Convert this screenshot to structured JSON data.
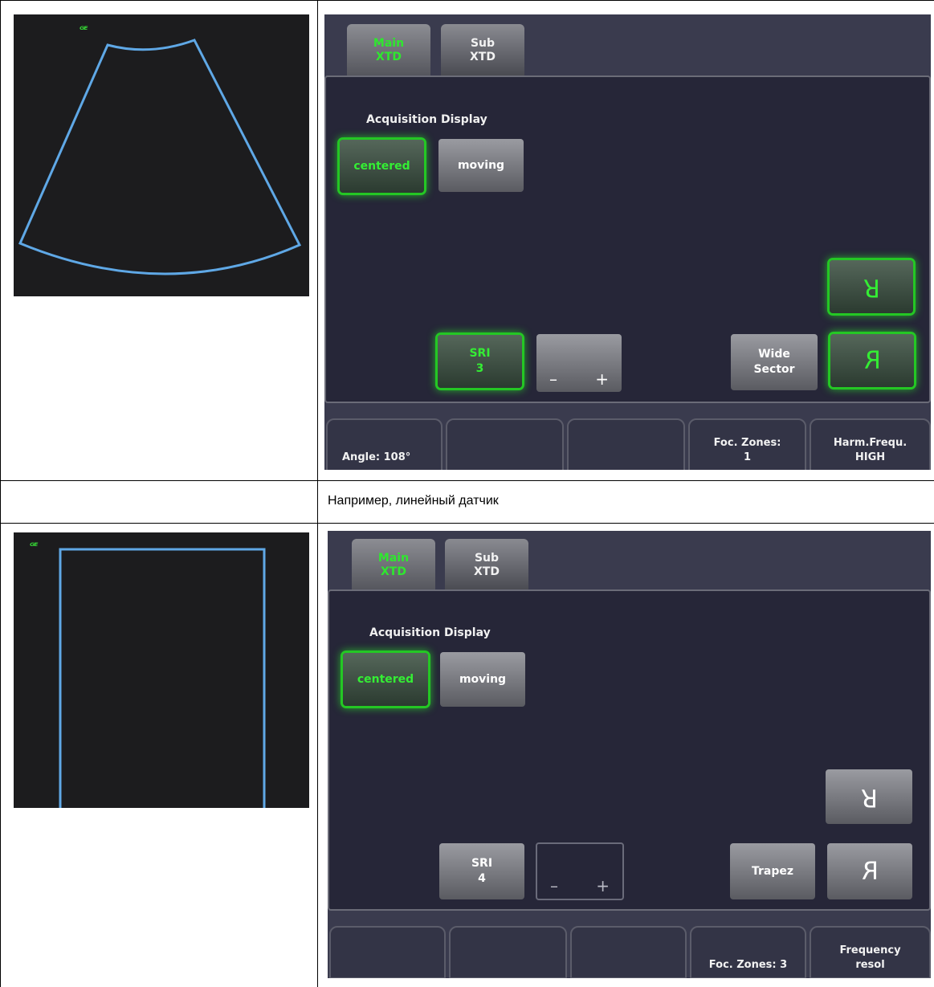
{
  "caption": "Например, линейный датчик",
  "colors": {
    "outline": "#5fa8e6",
    "active_green": "#2ee82e",
    "logo_green": "#35d435"
  },
  "block1": {
    "logo": "ᴳᴱ",
    "tabs": [
      {
        "line1": "Main",
        "line2": "XTD",
        "active": true
      },
      {
        "line1": "Sub",
        "line2": "XTD",
        "active": false
      }
    ],
    "section_label": "Acquisition Display",
    "centered_label": "centered",
    "moving_label": "moving",
    "sri_label": "SRI",
    "sri_value": "3",
    "minus": "–",
    "plus": "+",
    "wide_line1": "Wide",
    "wide_line2": "Sector",
    "flip_lr_glyph": "R",
    "flip_ud_glyph": "R",
    "status": [
      {
        "line1": "Angle:   108°",
        "line2": ""
      },
      {
        "line1": "",
        "line2": ""
      },
      {
        "line1": "",
        "line2": ""
      },
      {
        "line1": "Foc. Zones:",
        "line2": "1"
      },
      {
        "line1": "Harm.Frequ.",
        "line2": "HIGH"
      }
    ]
  },
  "block2": {
    "logo": "ᴳᴱ",
    "tabs": [
      {
        "line1": "Main",
        "line2": "XTD",
        "active": true
      },
      {
        "line1": "Sub",
        "line2": "XTD",
        "active": false
      }
    ],
    "section_label": "Acquisition Display",
    "centered_label": "centered",
    "moving_label": "moving",
    "sri_label": "SRI",
    "sri_value": "4",
    "minus": "–",
    "plus": "+",
    "trapez_label": "Trapez",
    "flip_lr_glyph": "R",
    "flip_ud_glyph": "R",
    "status": [
      {
        "line1": "",
        "line2": ""
      },
      {
        "line1": "",
        "line2": ""
      },
      {
        "line1": "",
        "line2": ""
      },
      {
        "line1": "Foc. Zones: 3",
        "line2": ""
      },
      {
        "line1": "Frequency",
        "line2": "resol"
      }
    ]
  }
}
